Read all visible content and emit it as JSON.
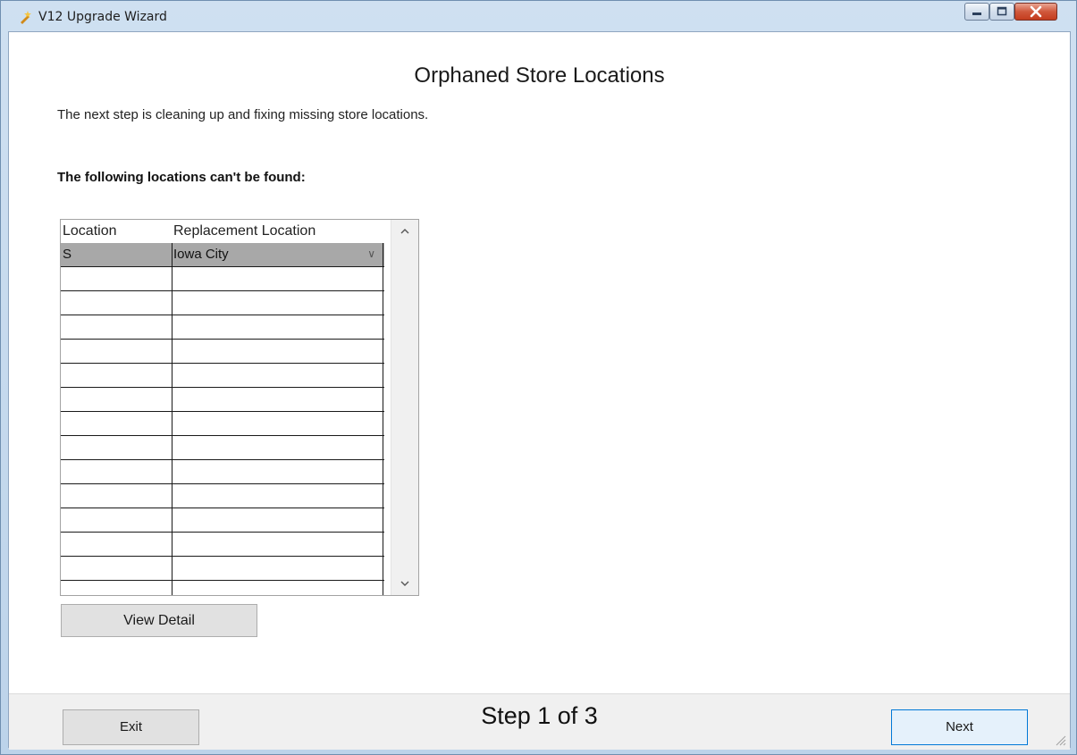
{
  "window": {
    "title": "V12 Upgrade Wizard",
    "icons": {
      "app": "wizard-icon",
      "minimize": "minimize-icon",
      "maximize": "maximize-icon",
      "close": "close-icon"
    }
  },
  "page": {
    "title": "Orphaned Store Locations",
    "description": "The next step is cleaning up and fixing missing store locations.",
    "section_label": "The following locations can't be found:"
  },
  "grid": {
    "columns": [
      "Location",
      "Replacement Location"
    ],
    "rows": [
      {
        "location": "S",
        "replacement": "Iowa City",
        "selected": true
      },
      {
        "location": "",
        "replacement": ""
      },
      {
        "location": "",
        "replacement": ""
      },
      {
        "location": "",
        "replacement": ""
      },
      {
        "location": "",
        "replacement": ""
      },
      {
        "location": "",
        "replacement": ""
      },
      {
        "location": "",
        "replacement": ""
      },
      {
        "location": "",
        "replacement": ""
      },
      {
        "location": "",
        "replacement": ""
      },
      {
        "location": "",
        "replacement": ""
      },
      {
        "location": "",
        "replacement": ""
      },
      {
        "location": "",
        "replacement": ""
      },
      {
        "location": "",
        "replacement": ""
      },
      {
        "location": "",
        "replacement": ""
      }
    ],
    "scroll_up_icon": "chevron-up-icon",
    "scroll_down_icon": "chevron-down-icon",
    "dropdown_icon": "chevron-down-icon"
  },
  "buttons": {
    "view_detail": "View Detail",
    "exit": "Exit",
    "next": "Next"
  },
  "footer": {
    "step_text": "Step 1 of 3"
  }
}
